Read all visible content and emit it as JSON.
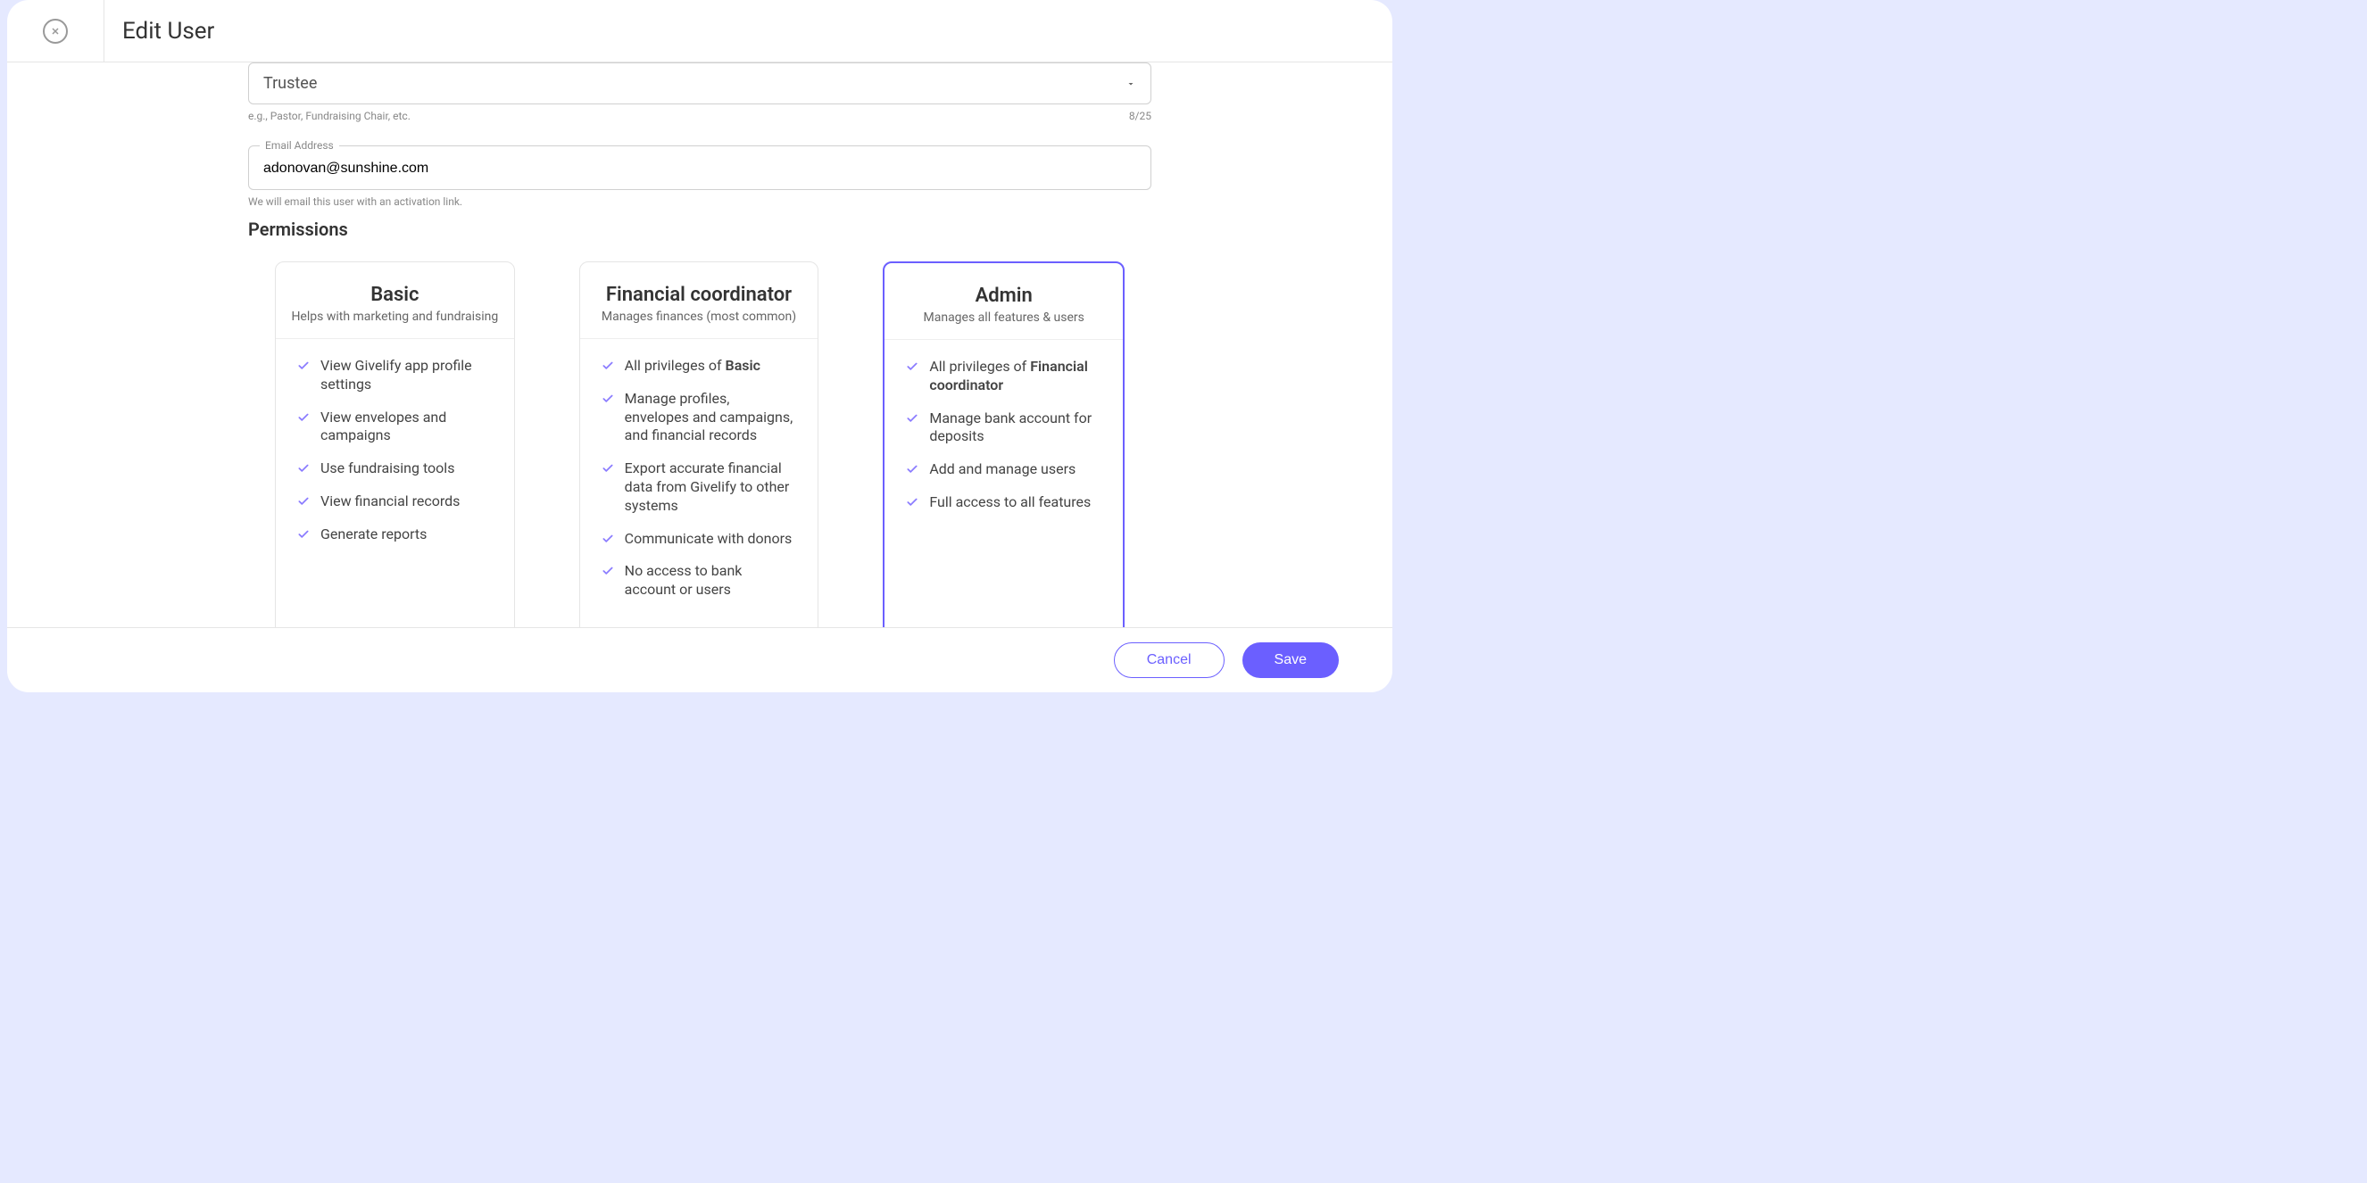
{
  "header": {
    "title": "Edit User"
  },
  "role": {
    "value": "Trustee",
    "helper": "e.g., Pastor, Fundraising Chair, etc.",
    "counter": "8/25"
  },
  "email": {
    "label": "Email Address",
    "value": "adonovan@sunshine.com",
    "helper": "We will email this user with an activation link."
  },
  "permissions": {
    "title": "Permissions",
    "cards": [
      {
        "title": "Basic",
        "subtitle": "Helps with marketing and fundraising",
        "features": [
          {
            "prefix": "",
            "bold": "",
            "text": "View Givelify app profile settings"
          },
          {
            "prefix": "",
            "bold": "",
            "text": "View envelopes and campaigns"
          },
          {
            "prefix": "",
            "bold": "",
            "text": "Use fundraising tools"
          },
          {
            "prefix": "",
            "bold": "",
            "text": "View financial records"
          },
          {
            "prefix": "",
            "bold": "",
            "text": "Generate reports"
          }
        ],
        "selected": false
      },
      {
        "title": "Financial coordinator",
        "subtitle": "Manages finances (most common)",
        "features": [
          {
            "prefix": "All privileges of ",
            "bold": "Basic",
            "text": ""
          },
          {
            "prefix": "",
            "bold": "",
            "text": "Manage profiles, envelopes and campaigns, and financial records"
          },
          {
            "prefix": "",
            "bold": "",
            "text": "Export accurate financial data from Givelify to other systems"
          },
          {
            "prefix": "",
            "bold": "",
            "text": "Communicate with donors"
          },
          {
            "prefix": "",
            "bold": "",
            "text": "No access to bank account or users"
          }
        ],
        "selected": false
      },
      {
        "title": "Admin",
        "subtitle": "Manages all features & users",
        "features": [
          {
            "prefix": "All privileges of ",
            "bold": "Financial coordinator",
            "text": ""
          },
          {
            "prefix": "",
            "bold": "",
            "text": "Manage bank account for deposits"
          },
          {
            "prefix": "",
            "bold": "",
            "text": "Add and manage users"
          },
          {
            "prefix": "",
            "bold": "",
            "text": "Full access to all features"
          }
        ],
        "selected": true
      }
    ]
  },
  "footer": {
    "cancel": "Cancel",
    "save": "Save"
  }
}
